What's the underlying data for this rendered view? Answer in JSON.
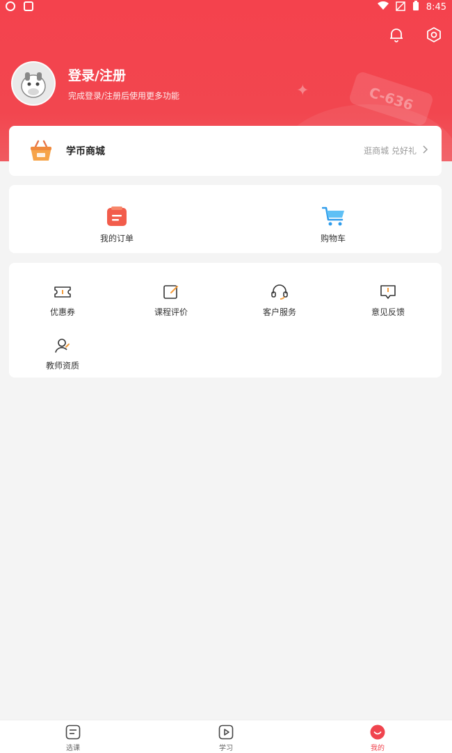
{
  "status_bar": {
    "time": "8:45"
  },
  "header": {
    "login_title": "登录/注册",
    "login_subtitle": "完成登录/注册后使用更多功能",
    "deco_ticket_text": "C-636"
  },
  "mall": {
    "title": "学币商城",
    "hint": "逛商城 兑好礼"
  },
  "orders": {
    "items": [
      {
        "label": "我的订单",
        "icon": "order-icon"
      },
      {
        "label": "购物车",
        "icon": "cart-icon"
      }
    ]
  },
  "tools": {
    "items": [
      {
        "label": "优惠券",
        "icon": "coupon-icon"
      },
      {
        "label": "课程评价",
        "icon": "review-icon"
      },
      {
        "label": "客户服务",
        "icon": "headset-icon"
      },
      {
        "label": "意见反馈",
        "icon": "feedback-icon"
      },
      {
        "label": "教师资质",
        "icon": "teacher-icon"
      }
    ]
  },
  "tabbar": {
    "items": [
      {
        "label": "选课",
        "icon": "course-icon"
      },
      {
        "label": "学习",
        "icon": "play-icon"
      },
      {
        "label": "我的",
        "icon": "profile-icon",
        "active": true
      }
    ]
  },
  "colors": {
    "brand": "#f0444e",
    "background": "#f4f4f4"
  }
}
